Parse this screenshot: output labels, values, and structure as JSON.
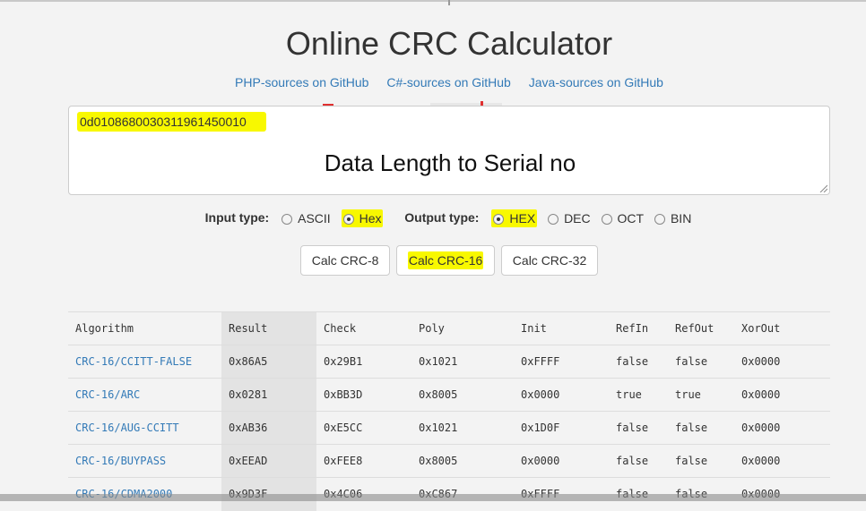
{
  "header": {
    "title": "Online CRC Calculator",
    "links": [
      "PHP-sources on GitHub",
      "C#-sources on GitHub",
      "Java-sources on GitHub"
    ]
  },
  "input": {
    "value": "0d0108680030311961450010",
    "overlay_text": "Data Length to Serial no"
  },
  "options": {
    "input_type_label": "Input type:",
    "input_types": [
      {
        "label": "ASCII",
        "checked": false
      },
      {
        "label": "Hex",
        "checked": true
      }
    ],
    "output_type_label": "Output type:",
    "output_types": [
      {
        "label": "HEX",
        "checked": true
      },
      {
        "label": "DEC",
        "checked": false
      },
      {
        "label": "OCT",
        "checked": false
      },
      {
        "label": "BIN",
        "checked": false
      }
    ]
  },
  "buttons": [
    "Calc CRC-8",
    "Calc CRC-16",
    "Calc CRC-32"
  ],
  "table": {
    "headers": [
      "Algorithm",
      "Result",
      "Check",
      "Poly",
      "Init",
      "RefIn",
      "RefOut",
      "XorOut"
    ],
    "rows": [
      [
        "CRC-16/CCITT-FALSE",
        "0x86A5",
        "0x29B1",
        "0x1021",
        "0xFFFF",
        "false",
        "false",
        "0x0000"
      ],
      [
        "CRC-16/ARC",
        "0x0281",
        "0xBB3D",
        "0x8005",
        "0x0000",
        "true",
        "true",
        "0x0000"
      ],
      [
        "CRC-16/AUG-CCITT",
        "0xAB36",
        "0xE5CC",
        "0x1021",
        "0x1D0F",
        "false",
        "false",
        "0x0000"
      ],
      [
        "CRC-16/BUYPASS",
        "0xEEAD",
        "0xFEE8",
        "0x8005",
        "0x0000",
        "false",
        "false",
        "0x0000"
      ],
      [
        "CRC-16/CDMA2000",
        "0x9D3F",
        "0x4C06",
        "0xC867",
        "0xFFFF",
        "false",
        "false",
        "0x0000"
      ]
    ]
  },
  "colors": {
    "highlight": "#f8f800",
    "link": "#337ab7",
    "result_column": "#e3e3e3"
  }
}
